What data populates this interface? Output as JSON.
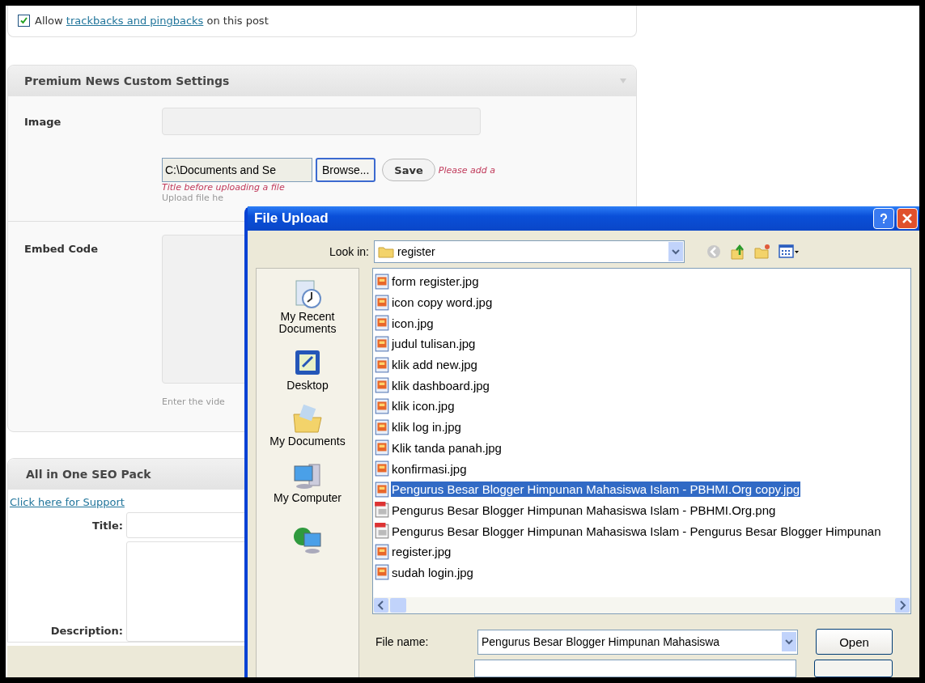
{
  "discussion": {
    "checked": true,
    "prefix": "Allow",
    "link": "trackbacks and pingbacks",
    "suffix": "on this post"
  },
  "custom_settings": {
    "title": "Premium News Custom Settings",
    "image_label": "Image",
    "file_path": "C:\\Documents and Se",
    "browse": "Browse...",
    "save": "Save",
    "error_start": "Please add a",
    "error_end": "Title before uploading a file",
    "upload_hint": "Upload file he",
    "embed_label": "Embed Code",
    "embed_hint": "Enter the vide"
  },
  "seo": {
    "title": "All in One SEO Pack",
    "support_link": "Click here for Support",
    "title_label": "Title:",
    "description_label": "Description:"
  },
  "dialog": {
    "title": "File Upload",
    "look_in_label": "Look in:",
    "folder": "register",
    "places": [
      {
        "kind": "recent",
        "label": "My Recent Documents"
      },
      {
        "kind": "desktop",
        "label": "Desktop"
      },
      {
        "kind": "documents",
        "label": "My Documents"
      },
      {
        "kind": "computer",
        "label": "My Computer"
      },
      {
        "kind": "network"
      }
    ],
    "files": [
      {
        "name": "form register.jpg",
        "kind": "jpg",
        "selected": false
      },
      {
        "name": "icon copy word.jpg",
        "kind": "jpg",
        "selected": false
      },
      {
        "name": "icon.jpg",
        "kind": "jpg",
        "selected": false
      },
      {
        "name": "judul tulisan.jpg",
        "kind": "jpg",
        "selected": false
      },
      {
        "name": "klik add new.jpg",
        "kind": "jpg",
        "selected": false
      },
      {
        "name": "klik dashboard.jpg",
        "kind": "jpg",
        "selected": false
      },
      {
        "name": "klik icon.jpg",
        "kind": "jpg",
        "selected": false
      },
      {
        "name": "klik log in.jpg",
        "kind": "jpg",
        "selected": false
      },
      {
        "name": "Klik tanda panah.jpg",
        "kind": "jpg",
        "selected": false
      },
      {
        "name": "konfirmasi.jpg",
        "kind": "jpg",
        "selected": false
      },
      {
        "name": "Pengurus Besar Blogger Himpunan Mahasiswa Islam - PBHMI.Org copy.jpg",
        "kind": "jpg",
        "selected": true
      },
      {
        "name": "Pengurus Besar Blogger Himpunan Mahasiswa Islam - PBHMI.Org.png",
        "kind": "png",
        "selected": false
      },
      {
        "name": "Pengurus Besar Blogger Himpunan Mahasiswa Islam - Pengurus Besar Blogger Himpunan",
        "kind": "png",
        "selected": false
      },
      {
        "name": "register.jpg",
        "kind": "jpg",
        "selected": false
      },
      {
        "name": "sudah login.jpg",
        "kind": "jpg",
        "selected": false
      }
    ],
    "file_name_label": "File name:",
    "file_name": "Pengurus Besar Blogger Himpunan Mahasiswa",
    "open": "Open"
  }
}
